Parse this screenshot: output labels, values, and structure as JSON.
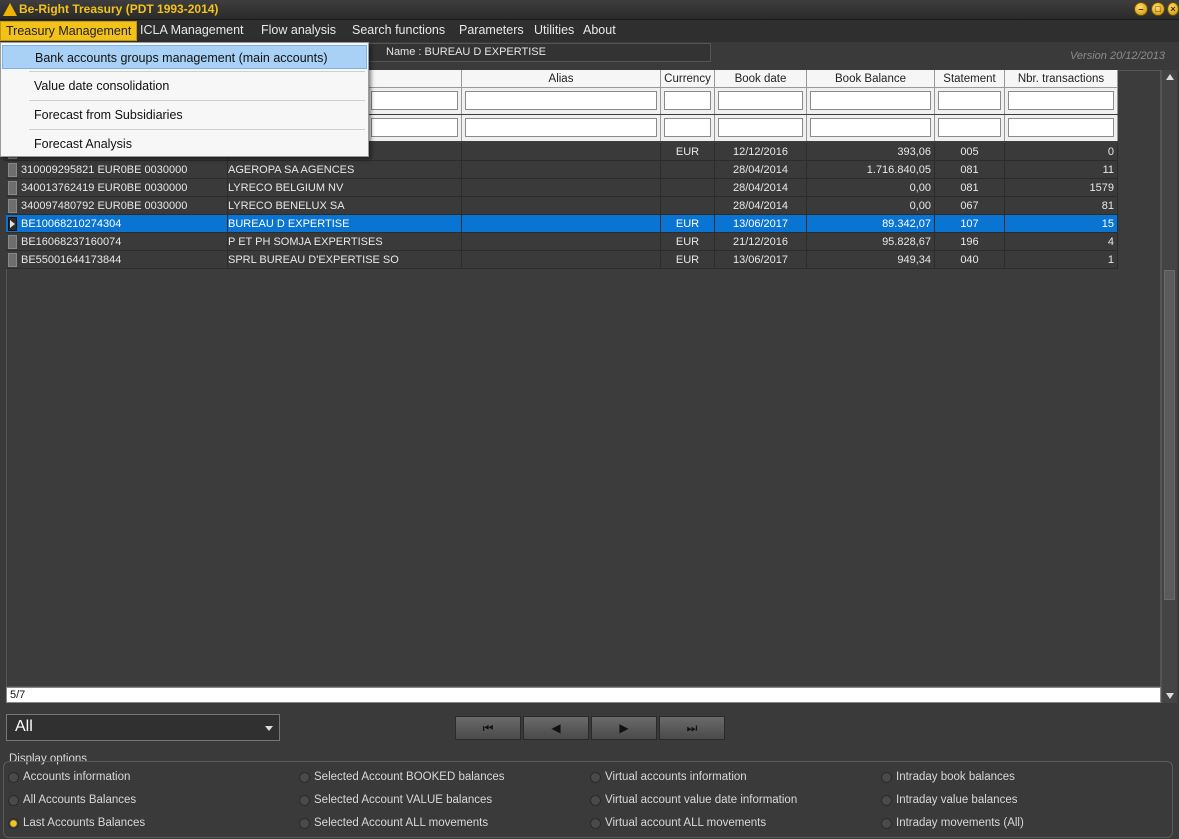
{
  "window": {
    "title": "Be-Right Treasury  (PDT 1993-2014)",
    "controls": [
      "minimize",
      "maximize",
      "close"
    ]
  },
  "menu": {
    "items": [
      "Treasury Management",
      "ICLA Management",
      "Flow analysis",
      "Search functions",
      "Parameters",
      "Utilities",
      "About"
    ],
    "dropdown": [
      "Bank accounts groups management (main accounts)",
      "Value date consolidation",
      "Forecast from Subsidiaries",
      "Forecast Analysis"
    ]
  },
  "header": {
    "name_label": "Name : BUREAU D EXPERTISE",
    "version": "Version 20/12/2013"
  },
  "grid": {
    "columns": [
      "Alias",
      "Currency",
      "Book date",
      "Book Balance",
      "Statement",
      "Nbr. transactions"
    ],
    "rows": [
      {
        "account": "",
        "name": "",
        "alias": "",
        "currency": "EUR",
        "book_date": "12/12/2016",
        "book_balance": "393,06",
        "statement": "005",
        "nbr": "0"
      },
      {
        "account": "310009295821 EUR0BE   0030000",
        "name": "AGEROPA SA AGENCES",
        "alias": "",
        "currency": "",
        "book_date": "28/04/2014",
        "book_balance": "1.716.840,05",
        "statement": "081",
        "nbr": "11"
      },
      {
        "account": "340013762419 EUR0BE   0030000",
        "name": "LYRECO BELGIUM NV",
        "alias": "",
        "currency": "",
        "book_date": "28/04/2014",
        "book_balance": "0,00",
        "statement": "081",
        "nbr": "1579"
      },
      {
        "account": "340097480792 EUR0BE   0030000",
        "name": "LYRECO BENELUX SA",
        "alias": "",
        "currency": "",
        "book_date": "28/04/2014",
        "book_balance": "0,00",
        "statement": "067",
        "nbr": "81"
      },
      {
        "account": "BE10068210274304",
        "name": "BUREAU D EXPERTISE",
        "alias": "",
        "currency": "EUR",
        "book_date": "13/06/2017",
        "book_balance": "89.342,07",
        "statement": "107",
        "nbr": "15",
        "selected": true
      },
      {
        "account": "BE16068237160074",
        "name": "P ET PH SOMJA EXPERTISES",
        "alias": "",
        "currency": "EUR",
        "book_date": "21/12/2016",
        "book_balance": "95.828,67",
        "statement": "196",
        "nbr": "4"
      },
      {
        "account": "BE55001644173844",
        "name": "SPRL BUREAU D'EXPERTISE SO",
        "alias": "",
        "currency": "EUR",
        "book_date": "13/06/2017",
        "book_balance": "949,34",
        "statement": "040",
        "nbr": "1"
      }
    ],
    "record_counter": "5/7"
  },
  "footer": {
    "filter_value": "All",
    "nav_buttons": [
      "first",
      "previous",
      "next",
      "last"
    ],
    "display_options_label": "Display options",
    "options": [
      [
        "Accounts information",
        "All Accounts Balances",
        "Last Accounts Balances"
      ],
      [
        "Selected Account BOOKED balances",
        "Selected Account VALUE balances",
        "Selected Account ALL movements"
      ],
      [
        "Virtual accounts information",
        "Virtual account value date information",
        "Virtual account ALL movements"
      ],
      [
        "Intraday book balances",
        "Intraday value balances",
        "Intraday movements (All)"
      ]
    ],
    "selected_option": "Last Accounts Balances"
  },
  "colors": {
    "accent": "#f2c21b",
    "selection": "#0a74d3",
    "menu_highlight": "#a8d1f5"
  }
}
